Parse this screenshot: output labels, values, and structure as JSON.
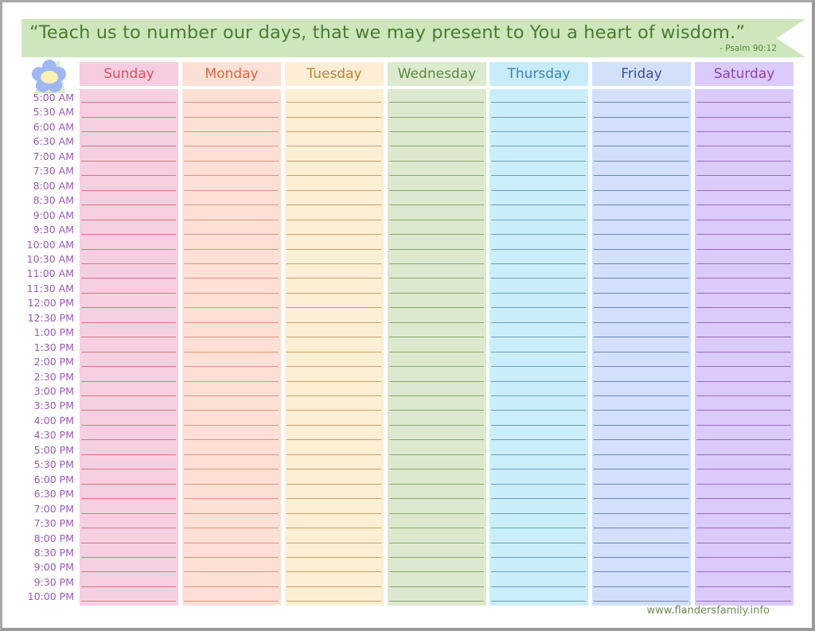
{
  "banner": {
    "quote": "“Teach us to number our days, that we may present to You a heart of wisdom.”",
    "reference": "- Psalm 90:12",
    "background": "#cde6bb",
    "text_color": "#4d7a32"
  },
  "decoration": {
    "icon": "flower-icon"
  },
  "days": [
    {
      "label": "Sunday",
      "text_color": "#d9525e",
      "header_bg": "#f5cddf",
      "body_bg": "#f6d0e1",
      "line_color": "#d8787c"
    },
    {
      "label": "Monday",
      "text_color": "#e0673f",
      "header_bg": "#fde0d6",
      "body_bg": "#fee0d6",
      "line_color": "#e0957c"
    },
    {
      "label": "Tuesday",
      "text_color": "#c08437",
      "header_bg": "#fdeed5",
      "body_bg": "#fdefd4",
      "line_color": "#caa06a"
    },
    {
      "label": "Wednesday",
      "text_color": "#5a8a3c",
      "header_bg": "#dcebd0",
      "body_bg": "#dde9cf",
      "line_color": "#8ba872"
    },
    {
      "label": "Thursday",
      "text_color": "#3a86b6",
      "header_bg": "#c9ecfb",
      "body_bg": "#cbeefb",
      "line_color": "#6a9fb8"
    },
    {
      "label": "Friday",
      "text_color": "#3a4f99",
      "header_bg": "#d3e0fa",
      "body_bg": "#d3e0fb",
      "line_color": "#6f86ae"
    },
    {
      "label": "Saturday",
      "text_color": "#8e44ad",
      "header_bg": "#dbcbfc",
      "body_bg": "#dacbfb",
      "line_color": "#9c6cc0"
    }
  ],
  "times": [
    "5:00 AM",
    "5:30 AM",
    "6:00 AM",
    "6:30 AM",
    "7:00 AM",
    "7:30 AM",
    "8:00 AM",
    "8:30 AM",
    "9:00 AM",
    "9:30 AM",
    "10:00 AM",
    "10:30 AM",
    "11:00 AM",
    "11:30 AM",
    "12:00 PM",
    "12:30 PM",
    "1:00 PM",
    "1:30 PM",
    "2:00 PM",
    "2:30 PM",
    "3:00 PM",
    "3:30 PM",
    "4:00 PM",
    "4:30 PM",
    "5:00 PM",
    "5:30 PM",
    "6:00 PM",
    "6:30 PM",
    "7:00 PM",
    "7:30 PM",
    "8:00 PM",
    "8:30 PM",
    "9:00 PM",
    "9:30 PM",
    "10:00 PM"
  ],
  "time_label_color": "#9b59b6",
  "footer": {
    "url": "www.flandersfamily.info"
  }
}
